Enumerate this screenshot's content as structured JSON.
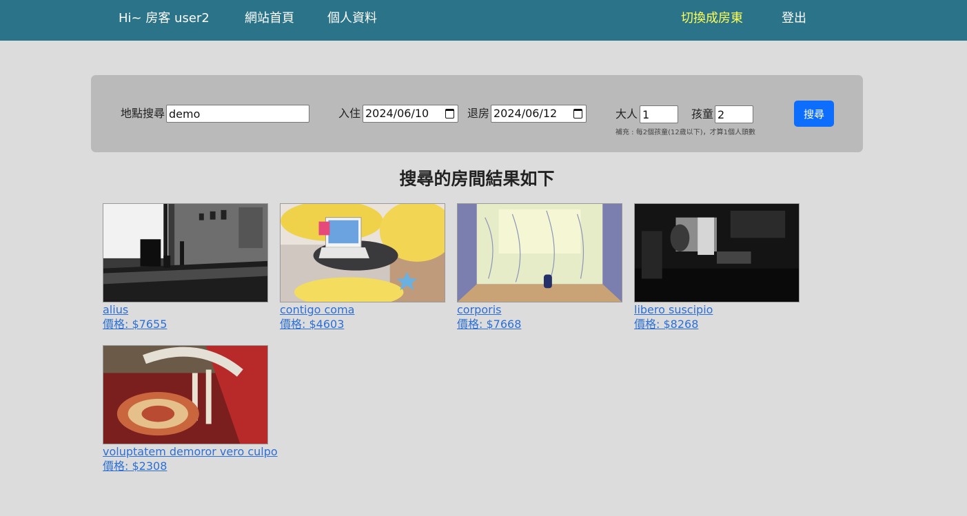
{
  "nav": {
    "greeting": "Hi~ 房客 user2",
    "home": "網站首頁",
    "profile": "個人資料",
    "switch_role": "切換成房東",
    "logout": "登出",
    "switch_color": "#ffff55"
  },
  "search": {
    "location_label": "地點搜尋",
    "location_value": "demo",
    "checkin_label": "入住",
    "checkin_value": "2024/06/10",
    "checkout_label": "退房",
    "checkout_value": "2024/06/12",
    "adults_label": "大人",
    "adults_value": "1",
    "children_label": "孩童",
    "children_value": "2",
    "hint": "補充 : 每2個孩童(12歲以下)，才算1個人頭數",
    "button_label": "搜尋",
    "button_color": "#0d6efd"
  },
  "results": {
    "title": "搜尋的房間結果如下",
    "rooms": [
      {
        "name": "alius",
        "price": "價格: $7655"
      },
      {
        "name": "contigo coma",
        "price": "價格: $4603"
      },
      {
        "name": "corporis",
        "price": "價格: $7668"
      },
      {
        "name": "libero suscipio",
        "price": "價格: $8268"
      },
      {
        "name": "voluptatem demoror vero culpo",
        "price": "價格: $2308"
      }
    ]
  },
  "colors": {
    "navbar": "#2b7389",
    "background": "#dcdcdc",
    "panel": "#bababa",
    "link": "#2b6fd6"
  }
}
